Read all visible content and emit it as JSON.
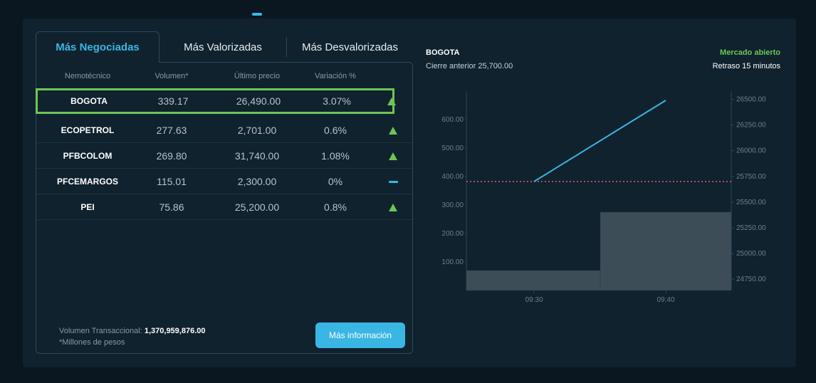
{
  "tabs": [
    {
      "label": "Más Negociadas",
      "active": true
    },
    {
      "label": "Más Valorizadas",
      "active": false
    },
    {
      "label": "Más Desvalorizadas",
      "active": false
    }
  ],
  "table": {
    "headers": [
      "Nemotécnico",
      "Volumen*",
      "Último precio",
      "Variación %"
    ],
    "rows": [
      {
        "name": "BOGOTA",
        "volume": "339.17",
        "price": "26,490.00",
        "change": "3.07%",
        "trend_icon": "arrow-up-icon"
      },
      {
        "name": "ECOPETROL",
        "volume": "277.63",
        "price": "2,701.00",
        "change": "0.6%",
        "trend_icon": "arrow-up-icon"
      },
      {
        "name": "PFBCOLOM",
        "volume": "269.80",
        "price": "31,740.00",
        "change": "1.08%",
        "trend_icon": "arrow-up-icon"
      },
      {
        "name": "PFCEMARGOS",
        "volume": "115.01",
        "price": "2,300.00",
        "change": "0%",
        "trend_icon": "flat-dash-icon"
      },
      {
        "name": "PEI",
        "volume": "75.86",
        "price": "25,200.00",
        "change": "0.8%",
        "trend_icon": "arrow-up-icon"
      }
    ]
  },
  "footer": {
    "volume_label": "Volumen Transaccional:",
    "volume_value": "1,370,959,876.00",
    "note": "*Millones de pesos",
    "more_button": "Más información"
  },
  "chart_header": {
    "title": "BOGOTA",
    "previous_close": "Cierre anterior 25,700.00",
    "market_status": "Mercado abierto",
    "delay": "Retraso 15 minutos"
  },
  "colors": {
    "accent": "#39b6e3",
    "positive": "#6cc655",
    "reference_line": "#e0616d",
    "volume_bars": "#3d4d57"
  },
  "chart_data": {
    "type": "bar",
    "x_ticks": [
      "09:30",
      "09:40"
    ],
    "left_axis": {
      "ticks": [
        "100.00",
        "200.00",
        "300.00",
        "400.00",
        "500.00",
        "600.00"
      ],
      "range": [
        0,
        700
      ]
    },
    "right_axis": {
      "ticks": [
        "24750.00",
        "25000.00",
        "25250.00",
        "25500.00",
        "25750.00",
        "26000.00",
        "26250.00",
        "26500.00"
      ],
      "range": [
        24640,
        26580
      ]
    },
    "volume_bars": [
      {
        "x": "09:30",
        "value": 70
      },
      {
        "x": "09:40",
        "value": 275
      }
    ],
    "price_line": [
      {
        "x": "09:30",
        "value": 25700
      },
      {
        "x": "09:40",
        "value": 26490
      }
    ],
    "reference_price": 25700
  }
}
